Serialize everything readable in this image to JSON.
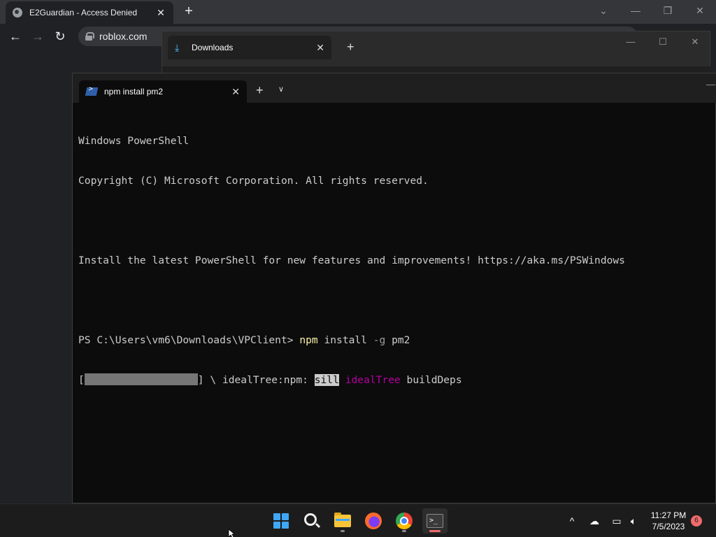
{
  "browser": {
    "tab_title": "E2Guardian - Access Denied",
    "url": "roblox.com"
  },
  "explorer": {
    "tab_title": "Downloads"
  },
  "terminal": {
    "tab_title": "npm install pm2",
    "lines": {
      "l1": "Windows PowerShell",
      "l2": "Copyright (C) Microsoft Corporation. All rights reserved.",
      "l4": "Install the latest PowerShell for new features and improvements! https://aka.ms/PSWindows",
      "prompt": "PS C:\\Users\\vm6\\Downloads\\VPClient> ",
      "cmd": "npm",
      "args": " install ",
      "flag": "-g",
      "pkg": " pm2",
      "progress_open": "[",
      "progress_close": "] \\ idealTree:npm: ",
      "level": "sill",
      "stage": "idealTree",
      "task": " buildDeps"
    }
  },
  "taskbar": {
    "time": "11:27 PM",
    "date": "7/5/2023",
    "notification_count": "6",
    "apps": [
      "start-icon",
      "search-icon",
      "file-explorer-icon",
      "firefox-icon",
      "chrome-icon",
      "terminal-icon"
    ]
  },
  "colors": {
    "terminal_bg": "#0c0c0c",
    "terminal_fg": "#cccccc",
    "command_yellow": "#f9f1a5",
    "magenta": "#b4009e",
    "notification_red": "#f06b6b"
  }
}
